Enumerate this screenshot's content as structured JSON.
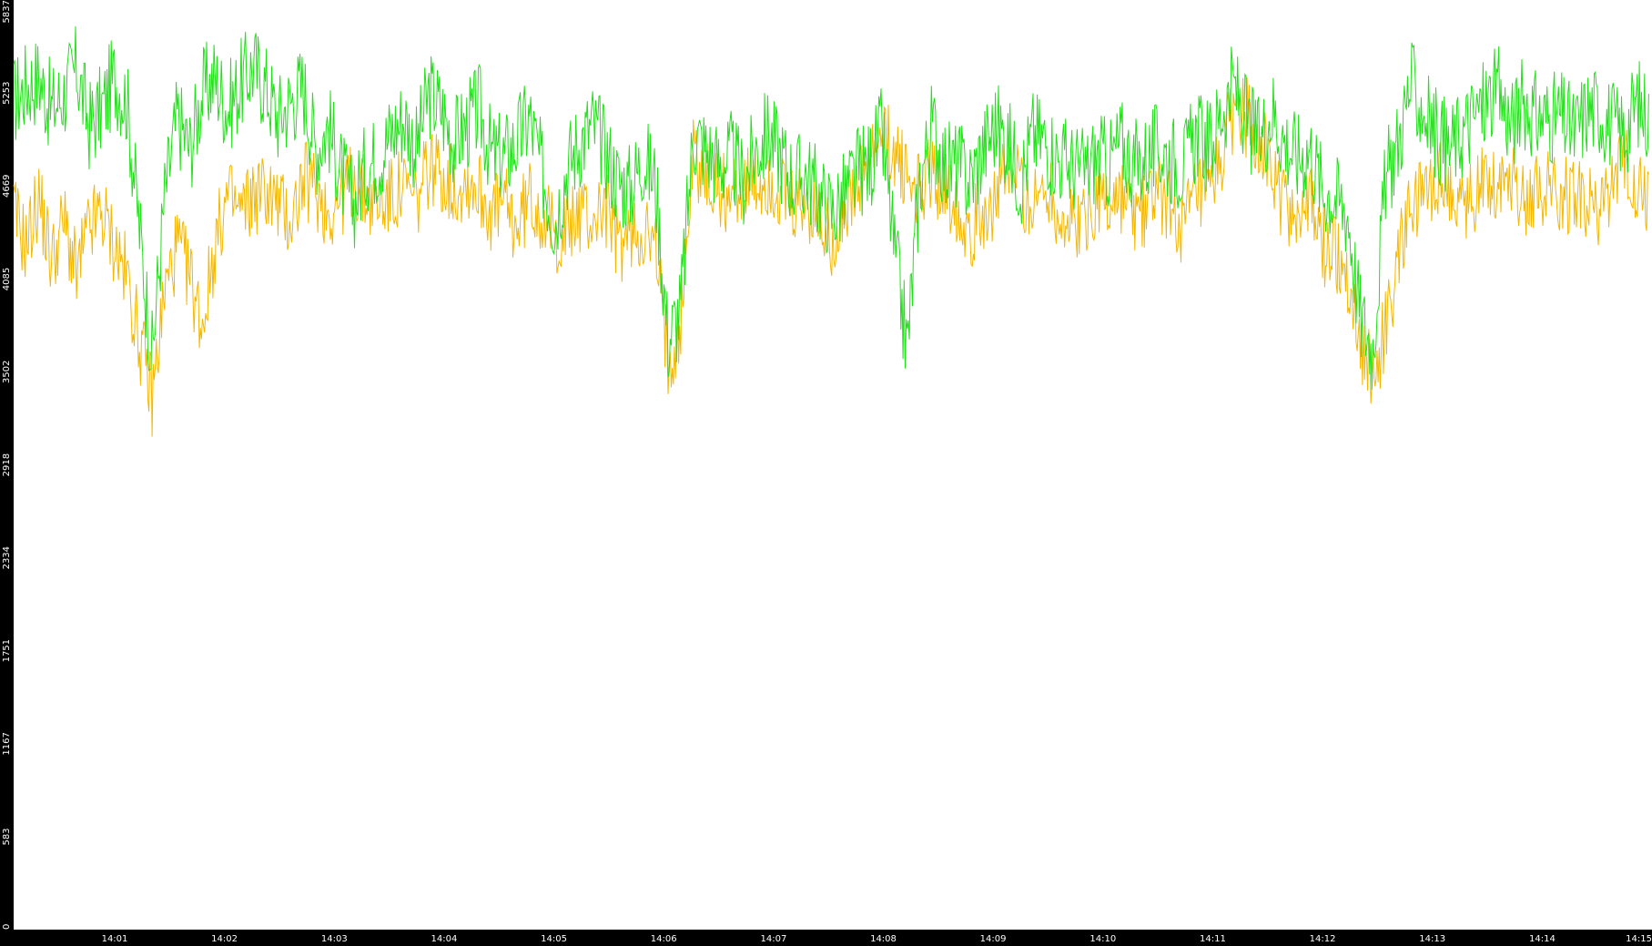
{
  "chart_data": {
    "type": "line",
    "title": "",
    "xlabel": "",
    "ylabel": "",
    "ylim": [
      0,
      5837
    ],
    "yticks": [
      0,
      583,
      1167,
      1751,
      2334,
      2918,
      3502,
      4085,
      4669,
      5253,
      5837
    ],
    "xticks": [
      "14:01",
      "14:02",
      "14:03",
      "14:04",
      "14:05",
      "14:06",
      "14:07",
      "14:08",
      "14:09",
      "14:10",
      "14:11",
      "14:12",
      "14:13",
      "14:14",
      "14:15"
    ],
    "xrange_minutes": [
      0.08,
      15.0
    ],
    "grid": false,
    "colors": {
      "background": "#000000",
      "plot_area": "#ffffff",
      "axis_text": "#ffffff"
    },
    "series": [
      {
        "color": "#22e01a",
        "values": [
          5200,
          5300,
          5350,
          5150,
          5250,
          5400,
          5050,
          5150,
          5350,
          5200,
          4400,
          3600,
          4600,
          5100,
          4900,
          5250,
          5350,
          5150,
          5300,
          5420,
          5300,
          5100,
          5200,
          5300,
          4900,
          5050,
          4750,
          4550,
          4800,
          4850,
          5000,
          5100,
          4900,
          5250,
          5150,
          4950,
          5050,
          5150,
          4850,
          4850,
          4950,
          5100,
          4750,
          4450,
          4800,
          4950,
          5050,
          4900,
          4700,
          4650,
          4850,
          4700,
          3700,
          3900,
          5000,
          4900,
          4800,
          4850,
          4700,
          4900,
          5000,
          4850,
          4700,
          4750,
          4600,
          4500,
          4600,
          4750,
          4800,
          5000,
          4250,
          3650,
          4700,
          5050,
          4800,
          4800,
          4700,
          4900,
          5050,
          4950,
          4700,
          5000,
          4950,
          4850,
          4800,
          4750,
          4850,
          4800,
          4950,
          4800,
          4850,
          4900,
          4850,
          4800,
          5000,
          4900,
          5150,
          5300,
          5050,
          4950,
          5150,
          4950,
          4850,
          4900,
          4650,
          4600,
          4500,
          3850,
          3650,
          4700,
          4950,
          5300,
          5150,
          5000,
          4900,
          5000,
          5100,
          5200,
          5250,
          5050,
          5200,
          5100,
          5100,
          5100,
          5000,
          5150,
          5150,
          5050,
          5000,
          5200,
          5100
        ]
      },
      {
        "color": "#f5b800",
        "values": [
          4500,
          4300,
          4600,
          4200,
          4450,
          4100,
          4400,
          4500,
          4300,
          4100,
          3700,
          3350,
          4000,
          4300,
          4100,
          3800,
          4300,
          4600,
          4500,
          4600,
          4650,
          4550,
          4450,
          4700,
          4650,
          4500,
          4600,
          4700,
          4600,
          4550,
          4600,
          4650,
          4550,
          4800,
          4750,
          4650,
          4700,
          4650,
          4500,
          4550,
          4400,
          4600,
          4500,
          4350,
          4400,
          4500,
          4450,
          4550,
          4300,
          4350,
          4400,
          4250,
          3600,
          3800,
          4900,
          4700,
          4650,
          4600,
          4700,
          4650,
          4700,
          4600,
          4500,
          4550,
          4450,
          4350,
          4500,
          4600,
          4800,
          4950,
          4900,
          4700,
          4650,
          4750,
          4650,
          4550,
          4400,
          4500,
          4600,
          4750,
          4700,
          4500,
          4700,
          4500,
          4400,
          4450,
          4600,
          4550,
          4600,
          4450,
          4550,
          4650,
          4500,
          4400,
          4600,
          4550,
          4850,
          5150,
          5100,
          5000,
          4700,
          4550,
          4500,
          4550,
          4300,
          4250,
          4100,
          3700,
          3450,
          3800,
          4200,
          4500,
          4600,
          4700,
          4650,
          4550,
          4600,
          4750,
          4700,
          4750,
          4600,
          4650,
          4700,
          4600,
          4650,
          4550,
          4500,
          4650,
          4800,
          4650,
          4550
        ]
      }
    ]
  }
}
